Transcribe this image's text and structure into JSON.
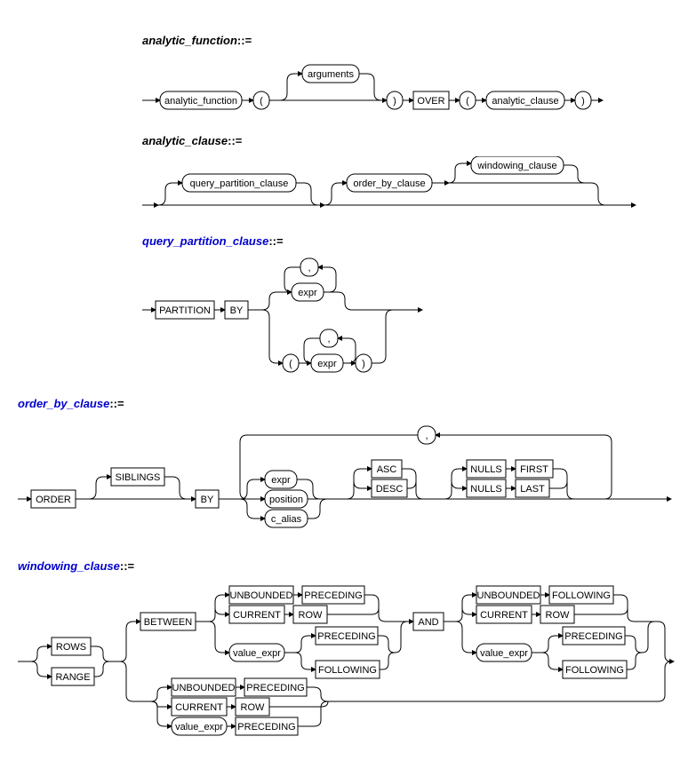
{
  "rules": {
    "analytic_function": {
      "title": "analytic_function",
      "suffix": "::=",
      "link": false
    },
    "analytic_clause": {
      "title": "analytic_clause",
      "suffix": "::=",
      "link": false
    },
    "query_partition_clause": {
      "title": "query_partition_clause",
      "suffix": "::=",
      "link": true
    },
    "order_by_clause": {
      "title": "order_by_clause",
      "suffix": "::=",
      "link": true
    },
    "windowing_clause": {
      "title": "windowing_clause",
      "suffix": "::=",
      "link": true
    }
  },
  "tokens": {
    "analytic_function": "analytic_function",
    "arguments": "arguments",
    "OVER": "OVER",
    "analytic_clause": "analytic_clause",
    "query_partition_clause": "query_partition_clause",
    "order_by_clause": "order_by_clause",
    "windowing_clause": "windowing_clause",
    "PARTITION": "PARTITION",
    "BY": "BY",
    "expr": "expr",
    "ORDER": "ORDER",
    "SIBLINGS": "SIBLINGS",
    "position": "position",
    "c_alias": "c_alias",
    "ASC": "ASC",
    "DESC": "DESC",
    "NULLS": "NULLS",
    "FIRST": "FIRST",
    "LAST": "LAST",
    "ROWS": "ROWS",
    "RANGE": "RANGE",
    "BETWEEN": "BETWEEN",
    "UNBOUNDED": "UNBOUNDED",
    "PRECEDING": "PRECEDING",
    "CURRENT": "CURRENT",
    "ROW": "ROW",
    "value_expr": "value_expr",
    "FOLLOWING": "FOLLOWING",
    "AND": "AND",
    "lparen": "(",
    "rparen": ")",
    "comma": ","
  }
}
